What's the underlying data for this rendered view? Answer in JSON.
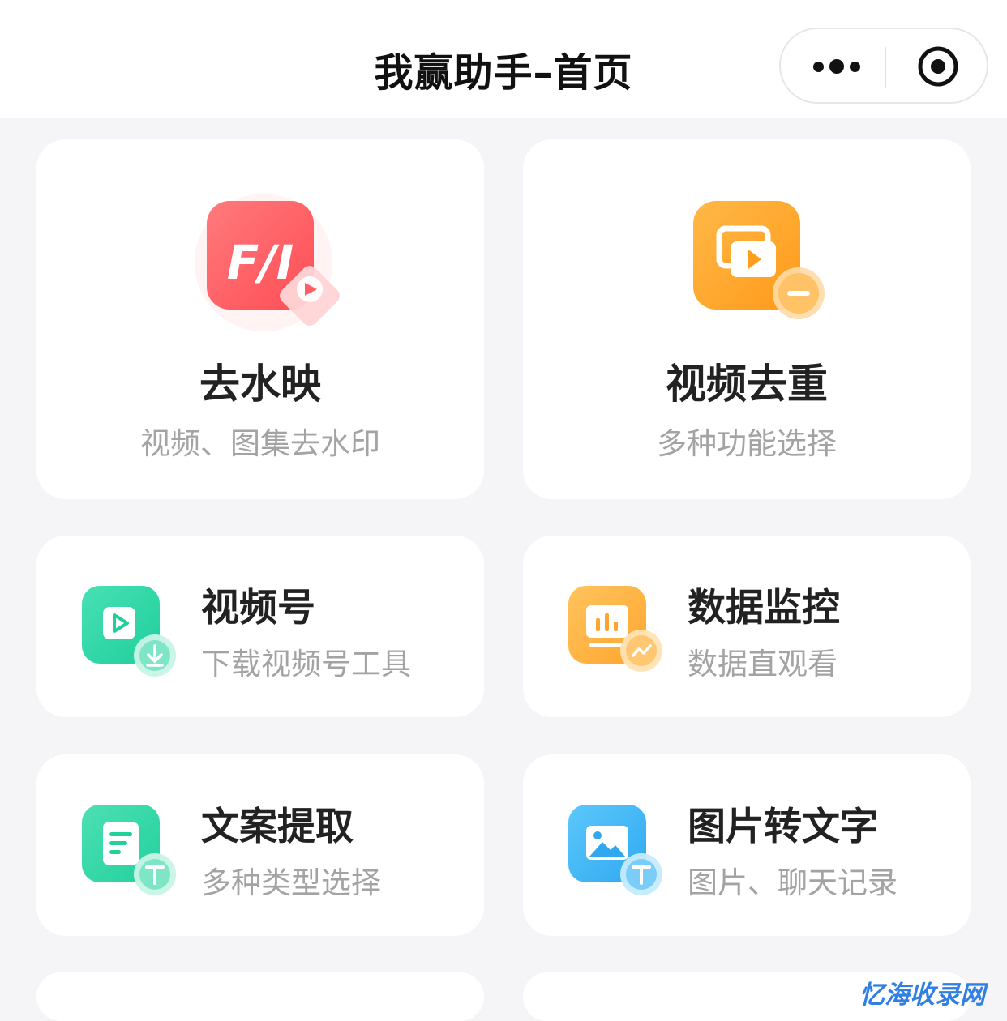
{
  "navbar": {
    "title": "我赢助手–首页",
    "more_icon": "more-dots-icon",
    "close_icon": "target-close-icon"
  },
  "cards": [
    {
      "title": "去水映",
      "subtitle": "视频、图集去水印",
      "icon": "watermark-remove-icon",
      "color": "#ff5f63"
    },
    {
      "title": "视频去重",
      "subtitle": "多种功能选择",
      "icon": "video-dedupe-icon",
      "color": "#ffa82e"
    },
    {
      "title": "视频号",
      "subtitle": "下载视频号工具",
      "icon": "video-download-icon",
      "color": "#2fd6a6"
    },
    {
      "title": "数据监控",
      "subtitle": "数据直观看",
      "icon": "data-monitor-icon",
      "color": "#ffb244"
    },
    {
      "title": "文案提取",
      "subtitle": "多种类型选择",
      "icon": "text-extract-icon",
      "color": "#35d6a4"
    },
    {
      "title": "图片转文字",
      "subtitle": "图片、聊天记录",
      "icon": "image-to-text-icon",
      "color": "#45b9f5"
    }
  ],
  "watermark": "忆海收录网"
}
